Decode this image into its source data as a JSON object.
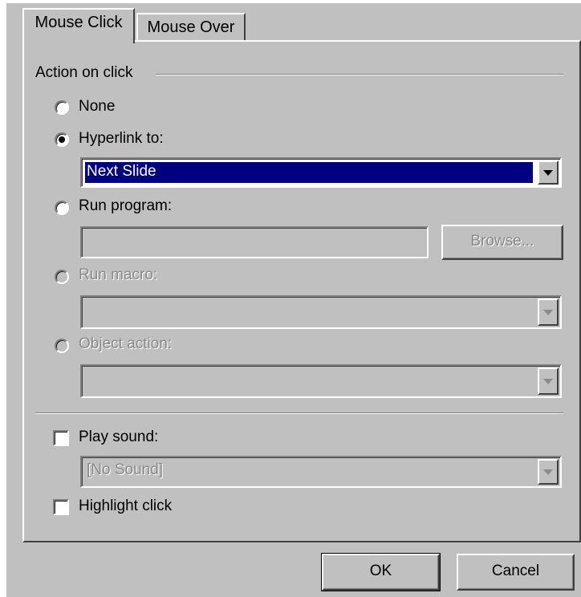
{
  "tabs": [
    {
      "label": "Mouse Click",
      "active": true
    },
    {
      "label": "Mouse Over",
      "active": false
    }
  ],
  "group": {
    "title": "Action on click"
  },
  "options": {
    "none": {
      "label": "None",
      "selected": false,
      "enabled": true
    },
    "hyperlink": {
      "label": "Hyperlink to:",
      "selected": true,
      "enabled": true,
      "value": "Next Slide"
    },
    "run_program": {
      "label": "Run program:",
      "selected": false,
      "enabled": true,
      "value": "",
      "browse_label": "Browse..."
    },
    "run_macro": {
      "label": "Run macro:",
      "selected": false,
      "enabled": false,
      "value": ""
    },
    "object_action": {
      "label": "Object action:",
      "selected": false,
      "enabled": false,
      "value": ""
    }
  },
  "play_sound": {
    "label": "Play sound:",
    "checked": false,
    "value": "[No Sound]"
  },
  "highlight_click": {
    "label": "Highlight click",
    "checked": false
  },
  "footer": {
    "ok_label": "OK",
    "cancel_label": "Cancel"
  },
  "colors": {
    "dialog_bg": "#c0c0c0",
    "selection_bg": "#000080",
    "selection_text": "#ffffff",
    "disabled_text": "#8a8a8a"
  }
}
